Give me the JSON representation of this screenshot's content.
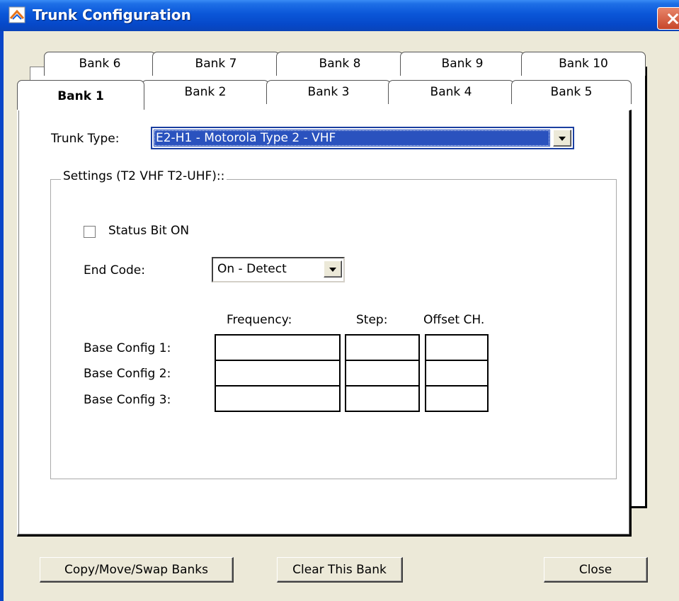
{
  "window": {
    "title": "Trunk Configuration",
    "close_glyph": "X",
    "title_icon": "app-icon"
  },
  "tabs_back": [
    {
      "label": "Bank 6"
    },
    {
      "label": "Bank 7"
    },
    {
      "label": "Bank 8"
    },
    {
      "label": "Bank 9"
    },
    {
      "label": "Bank 10"
    }
  ],
  "tabs_front": [
    {
      "label": "Bank 1",
      "active": true
    },
    {
      "label": "Bank 2"
    },
    {
      "label": "Bank 3"
    },
    {
      "label": "Bank 4"
    },
    {
      "label": "Bank 5"
    }
  ],
  "trunk_type": {
    "label": "Trunk Type:",
    "value": "E2-H1 - Motorola Type 2 - VHF"
  },
  "settings": {
    "title": "Settings (T2 VHF T2-UHF)::",
    "status_bit": {
      "label": "Status Bit ON",
      "checked": false
    },
    "end_code": {
      "label": "End Code:",
      "value": "On - Detect"
    },
    "columns": {
      "frequency": "Frequency:",
      "step": "Step:",
      "offset": "Offset CH."
    },
    "rows": [
      {
        "label": "Base Config 1:",
        "frequency": "",
        "step": "",
        "offset": ""
      },
      {
        "label": "Base Config 2:",
        "frequency": "",
        "step": "",
        "offset": ""
      },
      {
        "label": "Base Config 3:",
        "frequency": "",
        "step": "",
        "offset": ""
      }
    ]
  },
  "buttons": {
    "copy": "Copy/Move/Swap Banks",
    "clear": "Clear This Bank",
    "close": "Close"
  }
}
